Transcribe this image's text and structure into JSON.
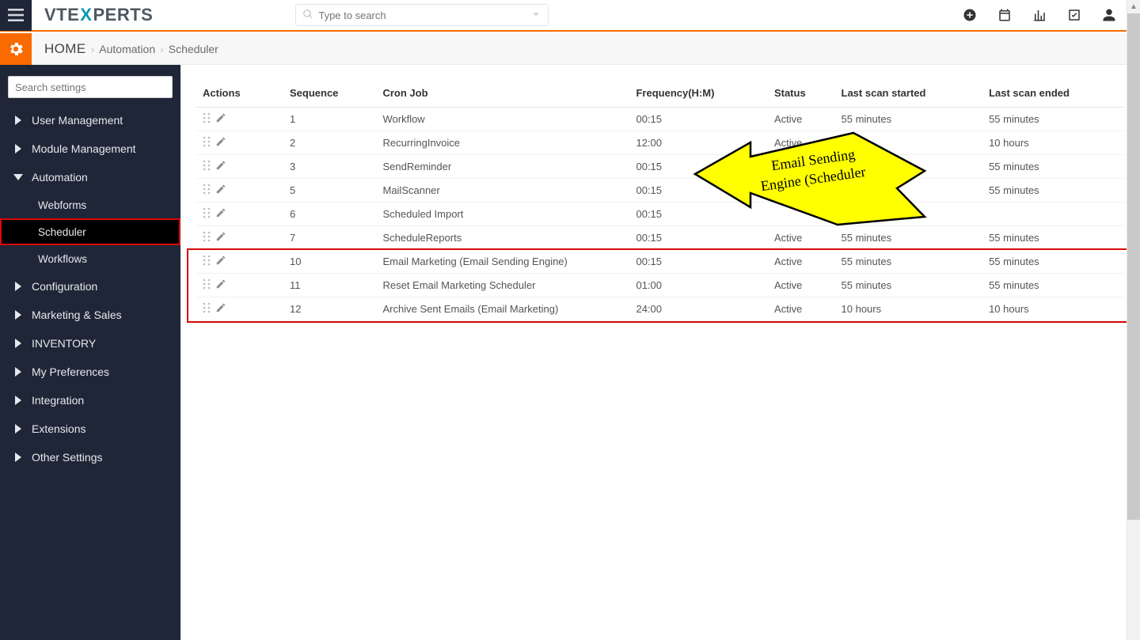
{
  "brand": {
    "pre": "VTE",
    "x": "X",
    "post": "PERTS"
  },
  "search": {
    "placeholder": "Type to search"
  },
  "breadcrumb": {
    "home": "HOME",
    "level1": "Automation",
    "level2": "Scheduler"
  },
  "sidebar": {
    "search_placeholder": "Search settings",
    "items": [
      {
        "label": "User Management",
        "open": false,
        "children": []
      },
      {
        "label": "Module Management",
        "open": false,
        "children": []
      },
      {
        "label": "Automation",
        "open": true,
        "children": [
          {
            "label": "Webforms",
            "active": false
          },
          {
            "label": "Scheduler",
            "active": true
          },
          {
            "label": "Workflows",
            "active": false
          }
        ]
      },
      {
        "label": "Configuration",
        "open": false,
        "children": []
      },
      {
        "label": "Marketing & Sales",
        "open": false,
        "children": []
      },
      {
        "label": "INVENTORY",
        "open": false,
        "children": []
      },
      {
        "label": "My Preferences",
        "open": false,
        "children": []
      },
      {
        "label": "Integration",
        "open": false,
        "children": []
      },
      {
        "label": "Extensions",
        "open": false,
        "children": []
      },
      {
        "label": "Other Settings",
        "open": false,
        "children": []
      }
    ]
  },
  "table": {
    "headers": {
      "actions": "Actions",
      "sequence": "Sequence",
      "cron": "Cron Job",
      "freq": "Frequency(H:M)",
      "status": "Status",
      "start": "Last scan started",
      "end": "Last scan ended"
    },
    "rows": [
      {
        "seq": "1",
        "cron": "Workflow",
        "freq": "00:15",
        "status": "Active",
        "start": "55 minutes",
        "end": "55 minutes",
        "hl": false
      },
      {
        "seq": "2",
        "cron": "RecurringInvoice",
        "freq": "12:00",
        "status": "Active",
        "start": "",
        "end": "10 hours",
        "hl": false
      },
      {
        "seq": "3",
        "cron": "SendReminder",
        "freq": "00:15",
        "status": "",
        "start": "",
        "end": "55 minutes",
        "hl": false
      },
      {
        "seq": "5",
        "cron": "MailScanner",
        "freq": "00:15",
        "status": "",
        "start": "",
        "end": "55 minutes",
        "hl": false
      },
      {
        "seq": "6",
        "cron": "Scheduled Import",
        "freq": "00:15",
        "status": "",
        "start": "",
        "end": "",
        "hl": false
      },
      {
        "seq": "7",
        "cron": "ScheduleReports",
        "freq": "00:15",
        "status": "Active",
        "start": "55 minutes",
        "end": "55 minutes",
        "hl": false
      },
      {
        "seq": "10",
        "cron": "Email Marketing (Email Sending Engine)",
        "freq": "00:15",
        "status": "Active",
        "start": "55 minutes",
        "end": "55 minutes",
        "hl": true
      },
      {
        "seq": "11",
        "cron": "Reset Email Marketing Scheduler",
        "freq": "01:00",
        "status": "Active",
        "start": "55 minutes",
        "end": "55 minutes",
        "hl": true
      },
      {
        "seq": "12",
        "cron": "Archive Sent Emails (Email Marketing)",
        "freq": "24:00",
        "status": "Active",
        "start": "10 hours",
        "end": "10 hours",
        "hl": true
      }
    ]
  },
  "callout": {
    "line1": "Email Sending",
    "line2": "Engine (Scheduler"
  }
}
